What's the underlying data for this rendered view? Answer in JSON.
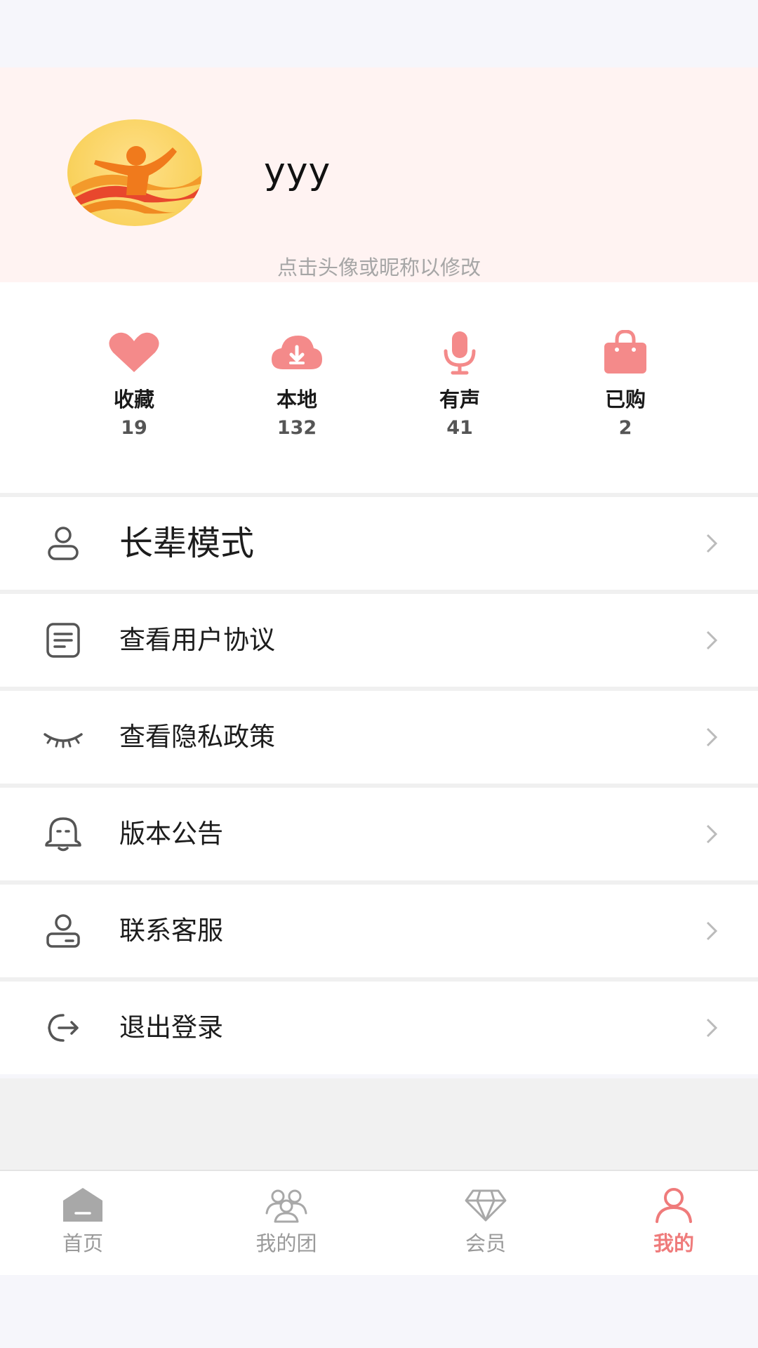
{
  "profile": {
    "nickname": "yyy",
    "edit_hint": "点击头像或昵称以修改"
  },
  "stats": [
    {
      "icon": "heart-icon",
      "label": "收藏",
      "count": "19"
    },
    {
      "icon": "cloud-download-icon",
      "label": "本地",
      "count": "132"
    },
    {
      "icon": "microphone-icon",
      "label": "有声",
      "count": "41"
    },
    {
      "icon": "shopping-bag-icon",
      "label": "已购",
      "count": "2"
    }
  ],
  "menu": [
    {
      "icon": "user-icon",
      "label": "长辈模式"
    },
    {
      "icon": "document-icon",
      "label": "查看用户协议"
    },
    {
      "icon": "closed-eye-icon",
      "label": "查看隐私政策"
    },
    {
      "icon": "bell-icon",
      "label": "版本公告"
    },
    {
      "icon": "customer-service-icon",
      "label": "联系客服"
    },
    {
      "icon": "logout-icon",
      "label": "退出登录"
    }
  ],
  "tabbar": [
    {
      "icon": "home-icon",
      "label": "首页"
    },
    {
      "icon": "group-icon",
      "label": "我的团"
    },
    {
      "icon": "diamond-icon",
      "label": "会员"
    },
    {
      "icon": "profile-icon",
      "label": "我的",
      "active": true
    }
  ],
  "colors": {
    "accent": "#ef7b7b",
    "header_bg": "#fff3f2",
    "icon_pink": "#f48a8a"
  }
}
